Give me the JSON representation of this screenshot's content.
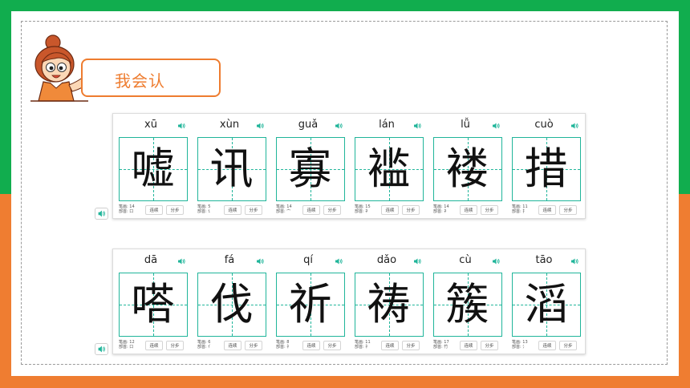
{
  "colors": {
    "top_band": "#11ad4e",
    "bottom_band": "#ef7d31",
    "accent": "#ee7c2f",
    "grid": "#20b59a",
    "speaker": "#20b59a"
  },
  "header": {
    "title": "我会认",
    "mascot_icon": "girl-mascot-pointing"
  },
  "labels": {
    "strokes": "笔画",
    "radical": "部首",
    "continuous": "连续",
    "step": "分步"
  },
  "rows": [
    {
      "chars": [
        {
          "pinyin": "xū",
          "hanzi": "嘘",
          "strokes": "14",
          "radical": "口"
        },
        {
          "pinyin": "xùn",
          "hanzi": "讯",
          "strokes": "5",
          "radical": "讠"
        },
        {
          "pinyin": "guǎ",
          "hanzi": "寡",
          "strokes": "14",
          "radical": "宀"
        },
        {
          "pinyin": "lán",
          "hanzi": "褴",
          "strokes": "15",
          "radical": "衤"
        },
        {
          "pinyin": "lǚ",
          "hanzi": "褛",
          "strokes": "14",
          "radical": "衤"
        },
        {
          "pinyin": "cuò",
          "hanzi": "措",
          "strokes": "11",
          "radical": "扌"
        }
      ]
    },
    {
      "chars": [
        {
          "pinyin": "dā",
          "hanzi": "嗒",
          "strokes": "12",
          "radical": "口"
        },
        {
          "pinyin": "fá",
          "hanzi": "伐",
          "strokes": "6",
          "radical": "亻"
        },
        {
          "pinyin": "qí",
          "hanzi": "祈",
          "strokes": "8",
          "radical": "礻"
        },
        {
          "pinyin": "dǎo",
          "hanzi": "祷",
          "strokes": "11",
          "radical": "礻"
        },
        {
          "pinyin": "cù",
          "hanzi": "簇",
          "strokes": "17",
          "radical": "竹"
        },
        {
          "pinyin": "tāo",
          "hanzi": "滔",
          "strokes": "13",
          "radical": "氵"
        }
      ]
    }
  ]
}
